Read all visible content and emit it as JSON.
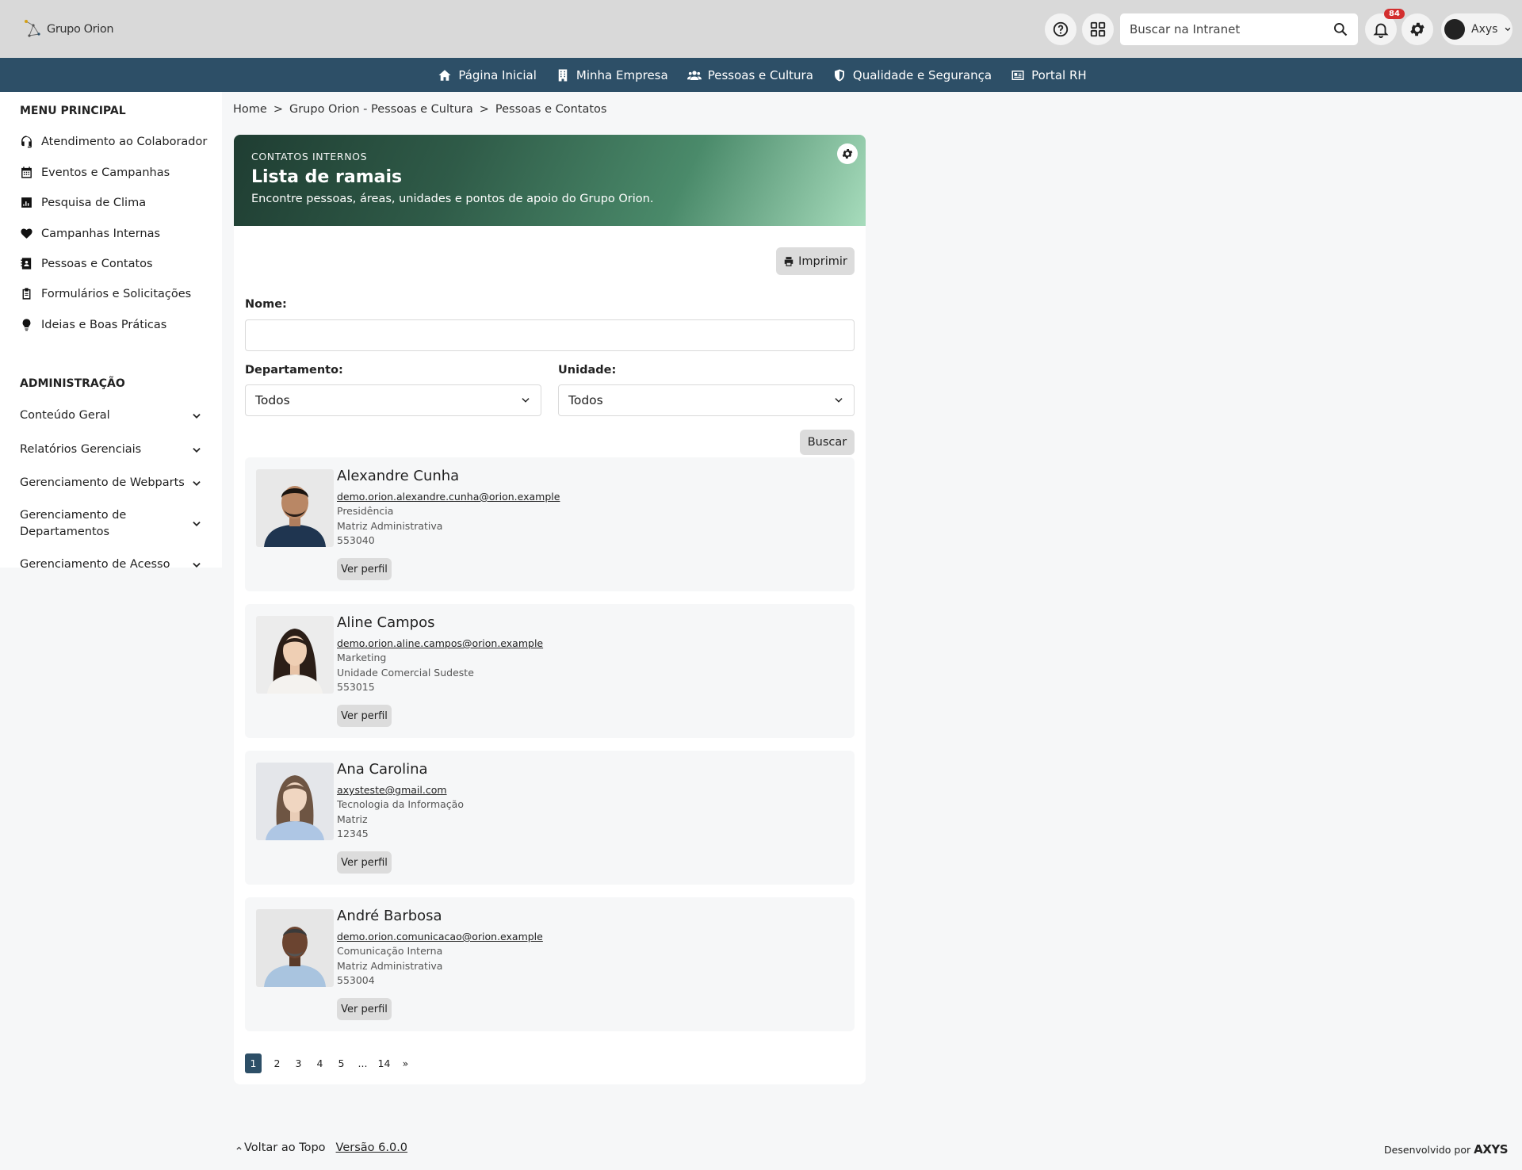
{
  "header": {
    "logo_text": "Grupo Orion",
    "search_placeholder": "Buscar na Intranet",
    "notifications_count": "84",
    "user_name": "Axys"
  },
  "nav": {
    "items": [
      {
        "label": "Página Inicial",
        "icon": "home-icon"
      },
      {
        "label": "Minha Empresa",
        "icon": "building-icon"
      },
      {
        "label": "Pessoas e Cultura",
        "icon": "users-icon"
      },
      {
        "label": "Qualidade e Segurança",
        "icon": "shield-icon"
      },
      {
        "label": "Portal RH",
        "icon": "id-card-icon"
      }
    ]
  },
  "sidebar": {
    "main_title": "MENU PRINCIPAL",
    "main_items": [
      {
        "label": "Atendimento ao Colaborador",
        "icon": "headset-icon"
      },
      {
        "label": "Eventos e Campanhas",
        "icon": "calendar-icon"
      },
      {
        "label": "Pesquisa de Clima",
        "icon": "chart-icon"
      },
      {
        "label": "Campanhas Internas",
        "icon": "heart-icon"
      },
      {
        "label": "Pessoas e Contatos",
        "icon": "contact-book-icon"
      },
      {
        "label": "Formulários e Solicitações",
        "icon": "clipboard-icon"
      },
      {
        "label": "Ideias e Boas Práticas",
        "icon": "lightbulb-icon"
      }
    ],
    "admin_title": "ADMINISTRAÇÃO",
    "admin_items": [
      {
        "label": "Conteúdo Geral"
      },
      {
        "label": "Relatórios Gerenciais"
      },
      {
        "label": "Gerenciamento de Webparts"
      },
      {
        "label": "Gerenciamento de Departamentos"
      },
      {
        "label": "Gerenciamento de Acesso"
      }
    ]
  },
  "breadcrumb": {
    "items": [
      "Home",
      "Grupo Orion - Pessoas e Cultura",
      "Pessoas e Contatos"
    ],
    "separator": ">"
  },
  "banner": {
    "eyebrow": "CONTATOS INTERNOS",
    "title": "Lista de ramais",
    "description": "Encontre pessoas, áreas, unidades e pontos de apoio do Grupo Orion."
  },
  "form": {
    "print_label": "Imprimir",
    "name_label": "Nome:",
    "name_value": "",
    "department_label": "Departamento:",
    "department_value": "Todos",
    "unit_label": "Unidade:",
    "unit_value": "Todos",
    "search_label": "Buscar"
  },
  "people": [
    {
      "name": "Alexandre Cunha",
      "email": "demo.orion.alexandre.cunha@orion.example",
      "department": "Presidência",
      "unit": "Matriz Administrativa",
      "extension": "553040",
      "button": "Ver perfil"
    },
    {
      "name": "Aline Campos",
      "email": "demo.orion.aline.campos@orion.example",
      "department": "Marketing",
      "unit": "Unidade Comercial Sudeste",
      "extension": "553015",
      "button": "Ver perfil"
    },
    {
      "name": "Ana Carolina",
      "email": "axysteste@gmail.com",
      "department": "Tecnologia da Informação",
      "unit": "Matriz",
      "extension": "12345",
      "button": "Ver perfil"
    },
    {
      "name": "André Barbosa",
      "email": "demo.orion.comunicacao@orion.example",
      "department": "Comunicação Interna",
      "unit": "Matriz Administrativa",
      "extension": "553004",
      "button": "Ver perfil"
    }
  ],
  "pagination": {
    "pages": [
      "1",
      "2",
      "3",
      "4",
      "5",
      "...",
      "14",
      "»"
    ],
    "current": "1"
  },
  "footer": {
    "back_to_top": "Voltar ao Topo",
    "version": "Versão 6.0.0",
    "developed_by": "Desenvolvido por",
    "brand": "AXYS"
  },
  "colors": {
    "nav_bg": "#2d4f67",
    "badge": "#d32f2f",
    "banner_start": "#1f3d32",
    "banner_end": "#a7dcbc"
  }
}
